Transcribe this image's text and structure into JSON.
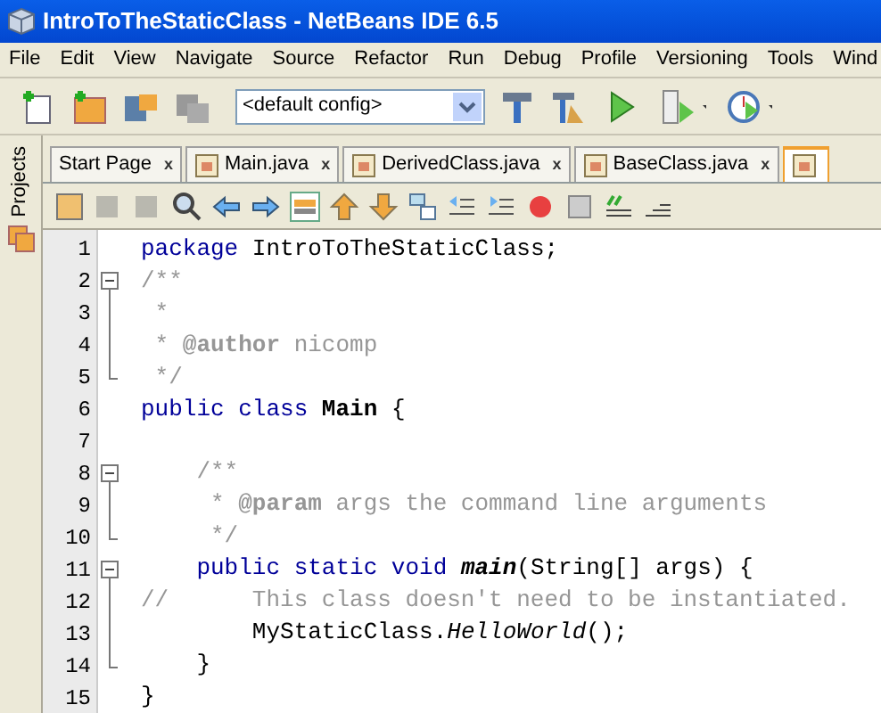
{
  "window": {
    "title": "IntroToTheStaticClass - NetBeans IDE 6.5"
  },
  "menu": [
    "File",
    "Edit",
    "View",
    "Navigate",
    "Source",
    "Refactor",
    "Run",
    "Debug",
    "Profile",
    "Versioning",
    "Tools",
    "Wind"
  ],
  "toolbar": {
    "config": "<default config>"
  },
  "sidebar": {
    "label": "Projects"
  },
  "tabs": [
    {
      "label": "Start Page",
      "close": "x",
      "selected": false,
      "icon": false
    },
    {
      "label": "Main.java",
      "close": "x",
      "selected": false,
      "icon": true
    },
    {
      "label": "DerivedClass.java",
      "close": "x",
      "selected": false,
      "icon": true
    },
    {
      "label": "BaseClass.java",
      "close": "x",
      "selected": false,
      "icon": true
    },
    {
      "selected": true,
      "icon": true
    }
  ],
  "lines": [
    {
      "number": "1",
      "tokens": [
        {
          "kind": "keyword",
          "text": "package "
        },
        {
          "kind": "plain",
          "text": "IntroToTheStaticClass;"
        }
      ]
    },
    {
      "number": "2",
      "kind": "foldstart",
      "tokens": [
        {
          "kind": "comment",
          "text": "/**"
        }
      ]
    },
    {
      "number": "3",
      "kind": "foldbody",
      "tokens": [
        {
          "kind": "comment",
          "text": " *"
        }
      ]
    },
    {
      "number": "4",
      "kind": "foldbody",
      "tokens": [
        {
          "kind": "comment",
          "text": " * "
        },
        {
          "kind": "tag",
          "text": "@author"
        },
        {
          "kind": "comment",
          "text": " nicomp"
        }
      ]
    },
    {
      "number": "5",
      "kind": "foldend",
      "tokens": [
        {
          "kind": "comment",
          "text": " */"
        }
      ]
    },
    {
      "number": "6",
      "tokens": [
        {
          "kind": "keyword",
          "text": "public class "
        },
        {
          "kind": "bold",
          "text": "Main"
        },
        {
          "kind": "plain",
          "text": " {"
        }
      ]
    },
    {
      "number": "7"
    },
    {
      "number": "8",
      "kind": "foldstart",
      "tokens": [
        {
          "kind": "comment",
          "text": "    /**"
        }
      ]
    },
    {
      "number": "9",
      "kind": "foldbody",
      "tokens": [
        {
          "kind": "comment",
          "text": "     * "
        },
        {
          "kind": "tag",
          "text": "@param"
        },
        {
          "kind": "comment",
          "text": " args the command line arguments"
        }
      ]
    },
    {
      "number": "10",
      "kind": "foldend",
      "tokens": [
        {
          "kind": "comment",
          "text": "     */"
        }
      ]
    },
    {
      "number": "11",
      "kind": "foldstart",
      "tokens": [
        {
          "kind": "keyword",
          "text": "    public static void "
        },
        {
          "kind": "bolditalic",
          "text": "main"
        },
        {
          "kind": "plain",
          "text": "(String[] args) {"
        }
      ]
    },
    {
      "number": "12",
      "kind": "foldbody",
      "tokens": [
        {
          "kind": "comment",
          "text": "//      This class doesn't need to be instantiated."
        }
      ]
    },
    {
      "number": "13",
      "kind": "foldbody",
      "tokens": [
        {
          "kind": "plain",
          "text": "        MyStaticClass."
        },
        {
          "kind": "italic",
          "text": "HelloWorld"
        },
        {
          "kind": "plain",
          "text": "();"
        }
      ]
    },
    {
      "number": "14",
      "kind": "foldend",
      "tokens": [
        {
          "kind": "plain",
          "text": "    }"
        }
      ]
    },
    {
      "number": "15",
      "tokens": [
        {
          "kind": "plain",
          "text": "}"
        }
      ]
    }
  ]
}
